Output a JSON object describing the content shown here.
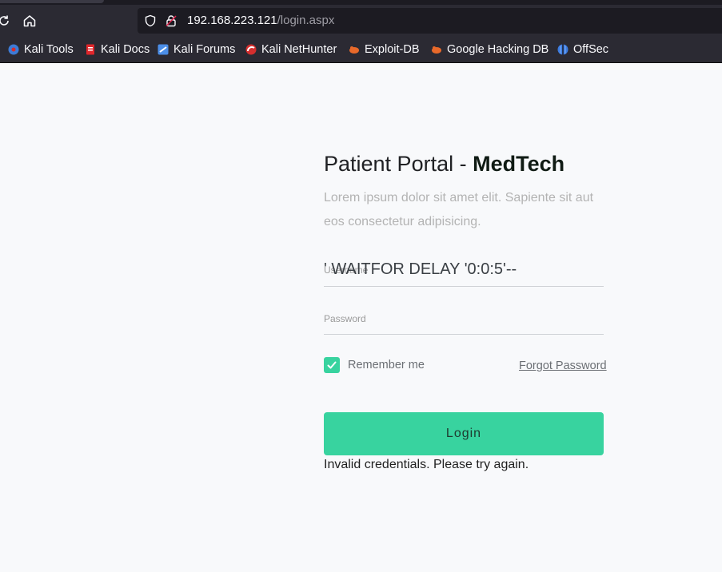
{
  "browser": {
    "url_host": "192.168.223.121",
    "url_path": "/login.aspx",
    "icons": [
      "reload-icon",
      "home-icon",
      "shield-icon",
      "insecure-lock-icon"
    ],
    "bookmarks": [
      {
        "label": "Kali Tools",
        "icon": "kali-tools-icon",
        "color": "#3d7bd6"
      },
      {
        "label": "Kali Docs",
        "icon": "kali-docs-icon",
        "color": "#e0262b"
      },
      {
        "label": "Kali Forums",
        "icon": "kali-forums-icon",
        "color": "#4b8ee8"
      },
      {
        "label": "Kali NetHunter",
        "icon": "kali-nethunter-icon",
        "color": "#d42e2e"
      },
      {
        "label": "Exploit-DB",
        "icon": "exploit-db-icon",
        "color": "#e8692a"
      },
      {
        "label": "Google Hacking DB",
        "icon": "ghdb-icon",
        "color": "#e8692a"
      },
      {
        "label": "OffSec",
        "icon": "offsec-icon",
        "color": "#3b7be0"
      }
    ]
  },
  "page": {
    "title_prefix": "Patient Portal - ",
    "title_brand": "MedTech",
    "description": "Lorem ipsum dolor sit amet elit. Sapiente sit aut eos consectetur adipisicing.",
    "username": {
      "label": "Username",
      "value": "' WAITFOR DELAY '0:0:5'--"
    },
    "password": {
      "label": "Password",
      "value": ""
    },
    "remember_label": "Remember me",
    "remember_checked": true,
    "forgot_label": "Forgot Password",
    "login_label": "Login",
    "error_message": "Invalid credentials. Please try again.",
    "accent_color": "#38d39f"
  }
}
